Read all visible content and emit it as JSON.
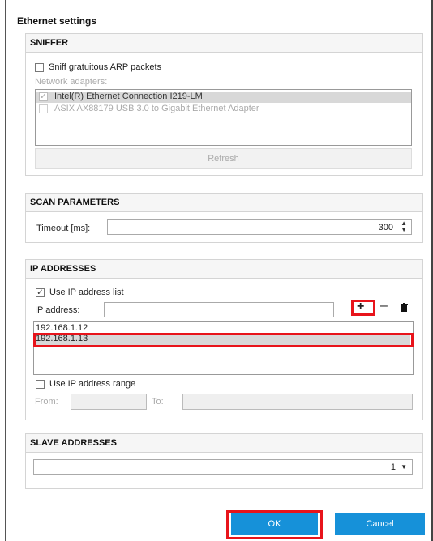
{
  "dialog": {
    "title": "Ethernet settings"
  },
  "sniffer": {
    "header": "SNIFFER",
    "gratuitous_arp": {
      "label": "Sniff gratuitous ARP packets",
      "checked": false
    },
    "adapters_label": "Network adapters:",
    "adapters": [
      {
        "name": "Intel(R) Ethernet Connection I219-LM",
        "checked": true,
        "selected": true
      },
      {
        "name": "ASIX AX88179 USB 3.0 to Gigabit Ethernet Adapter",
        "checked": false,
        "selected": false
      }
    ],
    "refresh_label": "Refresh"
  },
  "scan": {
    "header": "SCAN PARAMETERS",
    "timeout_label": "Timeout [ms]:",
    "timeout_value": "300"
  },
  "ip": {
    "header": "IP ADDRESSES",
    "use_list": {
      "label": "Use IP address list",
      "checked": true
    },
    "address_label": "IP address:",
    "address_value": "",
    "add_icon": "plus-icon",
    "remove_icon": "minus-icon",
    "delete_icon": "trash-icon",
    "list": [
      "192.168.1.12",
      "192.168.1.13"
    ],
    "selected_index": 1,
    "use_range": {
      "label": "Use IP address range",
      "checked": false
    },
    "from_label": "From:",
    "to_label": "To:"
  },
  "slave": {
    "header": "SLAVE ADDRESSES",
    "value": "1"
  },
  "footer": {
    "ok_label": "OK",
    "cancel_label": "Cancel"
  },
  "colors": {
    "accent": "#1691d9",
    "highlight": "#e8141b"
  }
}
